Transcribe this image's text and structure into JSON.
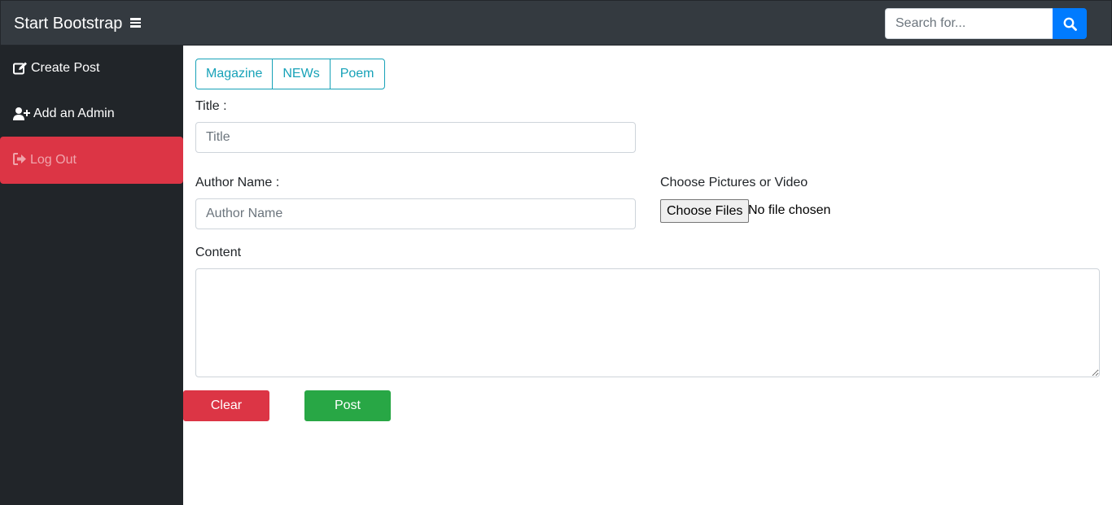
{
  "topbar": {
    "brand": "Start Bootstrap",
    "menu_icon": "bars-icon",
    "search": {
      "placeholder": "Search for...",
      "value": "",
      "icon": "search-icon"
    }
  },
  "sidebar": {
    "items": [
      {
        "label": "Create Post",
        "icon": "edit-icon"
      },
      {
        "label": "Add an Admin",
        "icon": "user-plus-icon"
      },
      {
        "label": "Log Out",
        "icon": "sign-out-icon"
      }
    ]
  },
  "form": {
    "categories": [
      "Magazine",
      "NEWs",
      "Poem"
    ],
    "title": {
      "label": "Title :",
      "placeholder": "Title",
      "value": ""
    },
    "author": {
      "label": "Author Name :",
      "placeholder": "Author Name",
      "value": ""
    },
    "media": {
      "label": "Choose Pictures or Video",
      "button": "Choose Files",
      "status": "No file chosen"
    },
    "content": {
      "label": "Content",
      "value": ""
    },
    "clear_label": "Clear",
    "post_label": "Post"
  },
  "colors": {
    "topbar": "#343a40",
    "sidebar": "#212529",
    "primary": "#007bff",
    "danger": "#dc3545",
    "success": "#28a745",
    "info": "#17a2b8"
  }
}
